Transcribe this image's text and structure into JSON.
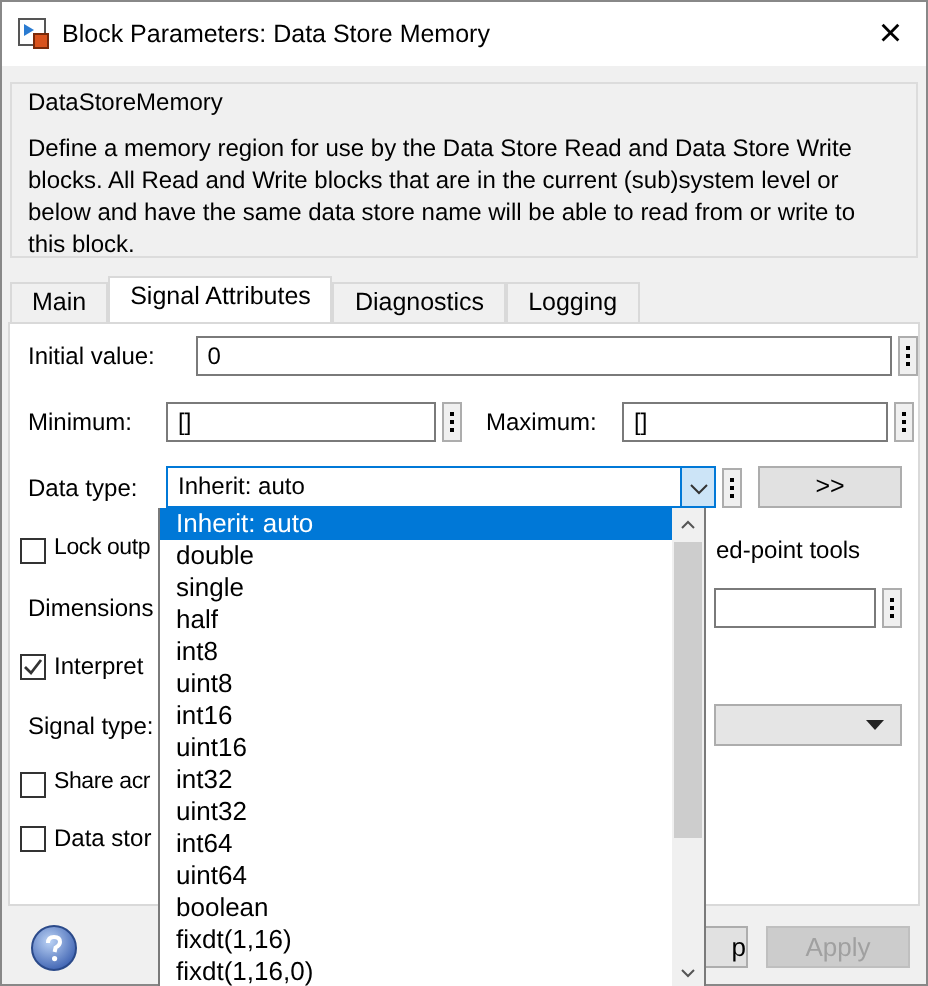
{
  "window": {
    "title": "Block Parameters: Data Store Memory",
    "close": "×"
  },
  "block": {
    "name": "DataStoreMemory",
    "description": "Define a memory region for use by the Data Store Read and Data Store Write blocks. All Read and Write blocks that are in the current (sub)system level or below and have the same data store name will be able to read from or write to this block."
  },
  "tabs": [
    {
      "label": "Main",
      "selected": false
    },
    {
      "label": "Signal Attributes",
      "selected": true
    },
    {
      "label": "Diagnostics",
      "selected": false
    },
    {
      "label": "Logging",
      "selected": false
    }
  ],
  "initial_value": {
    "label": "Initial value:",
    "value": "0"
  },
  "minimum": {
    "label": "Minimum:",
    "value": "[]"
  },
  "maximum": {
    "label": "Maximum:",
    "value": "[]"
  },
  "data_type": {
    "label": "Data type:",
    "value": "Inherit: auto",
    "expanded": true,
    "assistant_button": ">>"
  },
  "lock_output": {
    "label": "Lock outp",
    "label_right": "ed-point tools",
    "checked": false
  },
  "dimensions": {
    "label": "Dimensions"
  },
  "interpret": {
    "label": "Interpret",
    "checked": true
  },
  "signal_type": {
    "label": "Signal type:"
  },
  "share": {
    "label": "Share acr",
    "checked": false
  },
  "data_store": {
    "label": "Data stor",
    "checked": false
  },
  "dropdown_items": [
    {
      "label": "Inherit: auto",
      "selected": true
    },
    {
      "label": "double",
      "selected": false
    },
    {
      "label": "single",
      "selected": false
    },
    {
      "label": "half",
      "selected": false
    },
    {
      "label": "int8",
      "selected": false
    },
    {
      "label": "uint8",
      "selected": false
    },
    {
      "label": "int16",
      "selected": false
    },
    {
      "label": "uint16",
      "selected": false
    },
    {
      "label": "int32",
      "selected": false
    },
    {
      "label": "uint32",
      "selected": false
    },
    {
      "label": "int64",
      "selected": false
    },
    {
      "label": "uint64",
      "selected": false
    },
    {
      "label": "boolean",
      "selected": false
    },
    {
      "label": "fixdt(1,16)",
      "selected": false
    },
    {
      "label": "fixdt(1,16,0)",
      "selected": false
    }
  ],
  "buttons": [
    {
      "label": "p",
      "disabled": false
    },
    {
      "label": "Apply",
      "disabled": true
    }
  ]
}
